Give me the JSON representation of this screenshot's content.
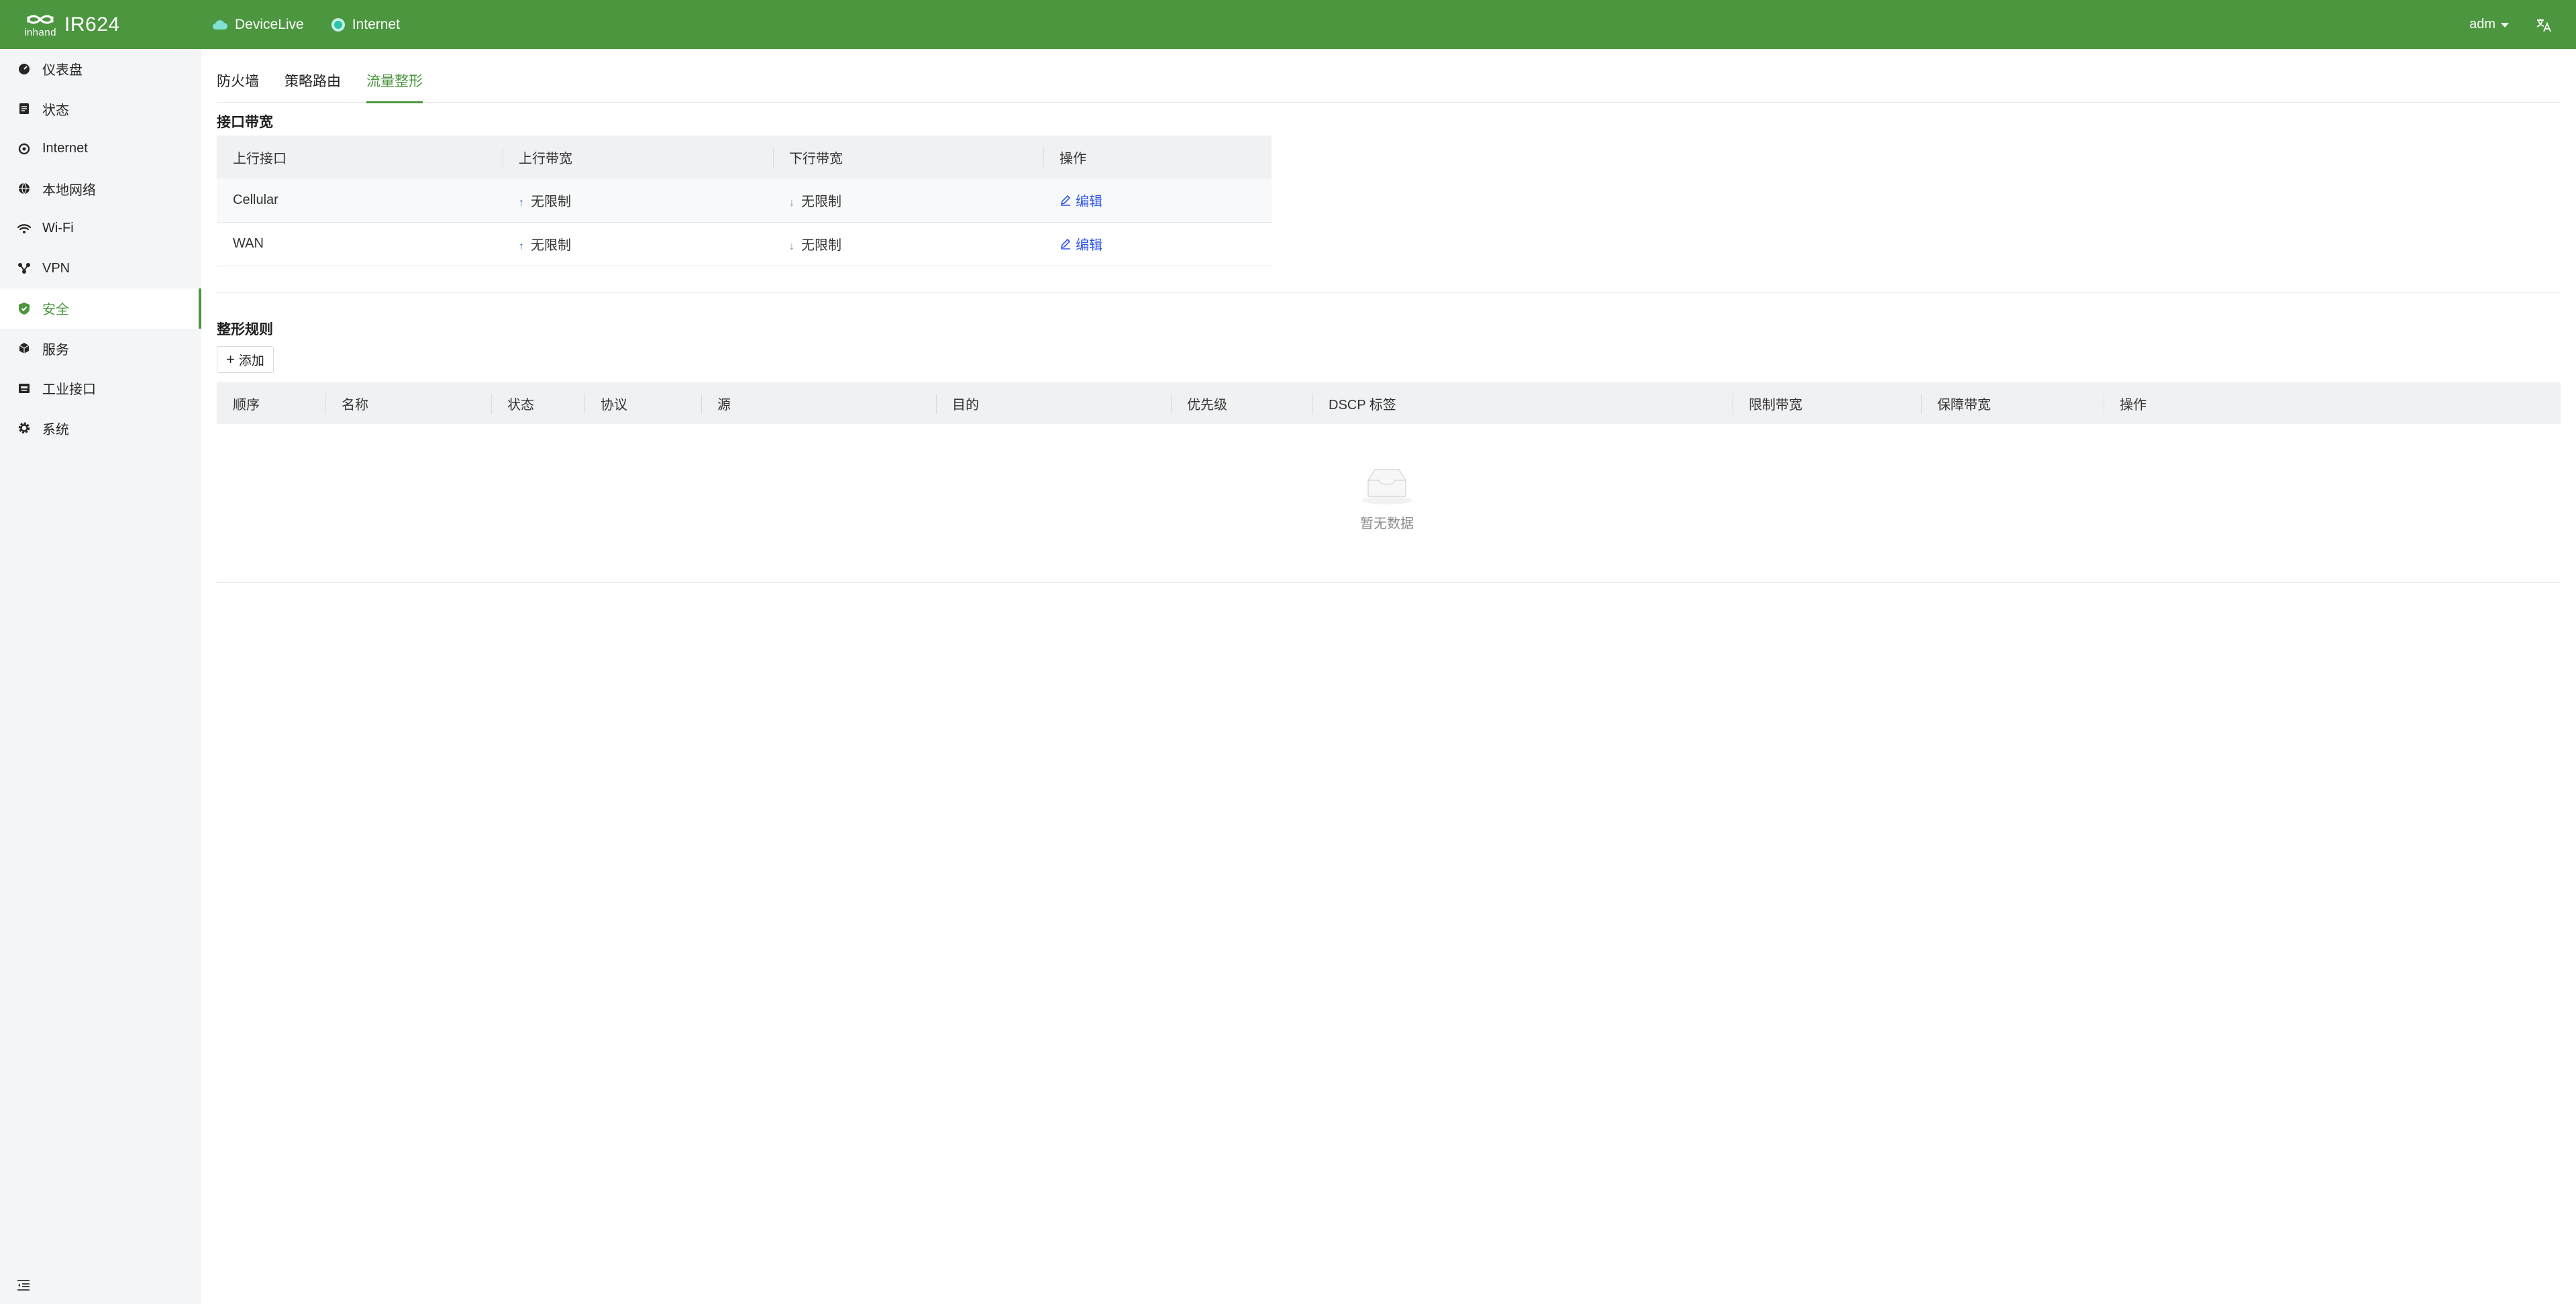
{
  "header": {
    "brand_sub": "inhand",
    "model": "IR624",
    "devicelive_label": "DeviceLive",
    "internet_label": "Internet",
    "user": "adm"
  },
  "sidebar": {
    "items": [
      {
        "label": "仪表盘",
        "icon": "dashboard-icon"
      },
      {
        "label": "状态",
        "icon": "status-icon"
      },
      {
        "label": "Internet",
        "icon": "internet-icon"
      },
      {
        "label": "本地网络",
        "icon": "local-network-icon"
      },
      {
        "label": "Wi-Fi",
        "icon": "wifi-icon"
      },
      {
        "label": "VPN",
        "icon": "vpn-icon"
      },
      {
        "label": "安全",
        "icon": "shield-icon",
        "active": true
      },
      {
        "label": "服务",
        "icon": "service-icon"
      },
      {
        "label": "工业接口",
        "icon": "industrial-interface-icon"
      },
      {
        "label": "系统",
        "icon": "gear-icon"
      }
    ]
  },
  "tabs": [
    {
      "label": "防火墙"
    },
    {
      "label": "策略路由"
    },
    {
      "label": "流量整形",
      "active": true
    }
  ],
  "bandwidth": {
    "title": "接口带宽",
    "columns": [
      "上行接口",
      "上行带宽",
      "下行带宽",
      "操作"
    ],
    "rows": [
      {
        "iface": "Cellular",
        "up": "无限制",
        "down": "无限制",
        "action": "编辑"
      },
      {
        "iface": "WAN",
        "up": "无限制",
        "down": "无限制",
        "action": "编辑"
      }
    ]
  },
  "rules": {
    "title": "整形规则",
    "add_label": "添加",
    "columns": [
      "顺序",
      "名称",
      "状态",
      "协议",
      "源",
      "目的",
      "优先级",
      "DSCP 标签",
      "限制带宽",
      "保障带宽",
      "操作"
    ],
    "empty_text": "暂无数据"
  },
  "colors": {
    "brand": "#4b963e",
    "link": "#2f54eb",
    "sidebar_bg": "#f4f5f7",
    "table_header_bg": "#f0f1f3"
  }
}
